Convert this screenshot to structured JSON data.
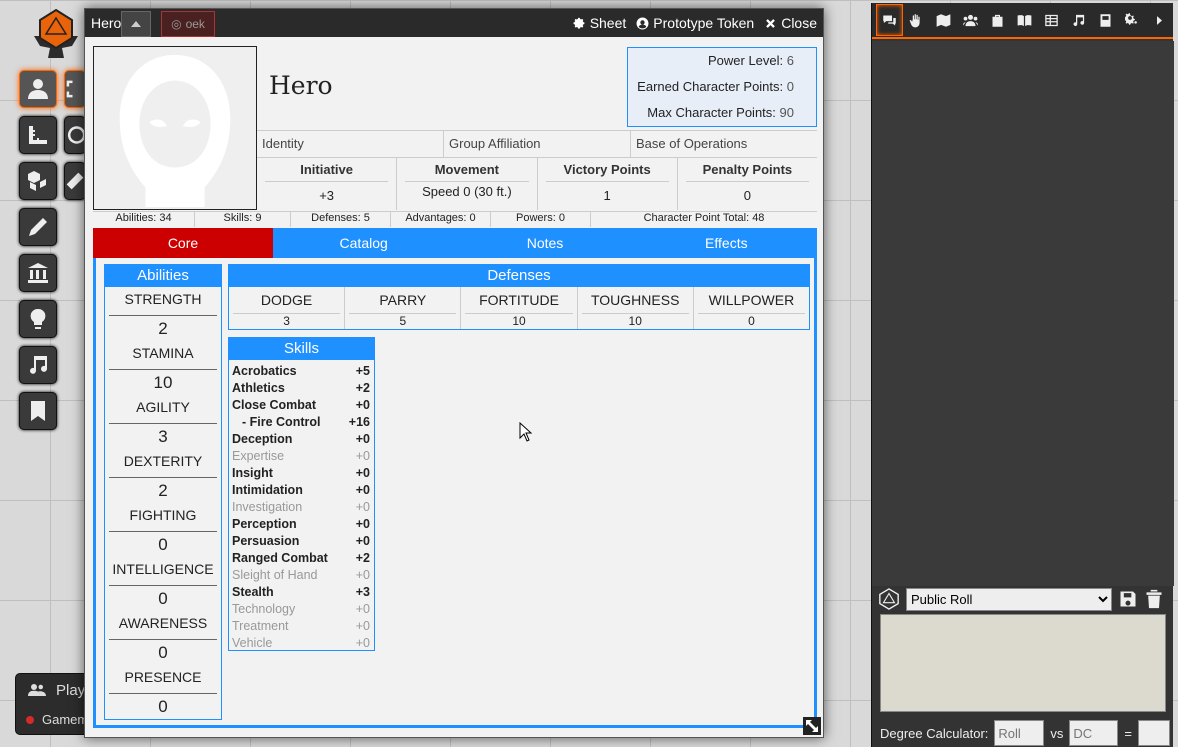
{
  "sheet": {
    "window_title": "Hero",
    "token_badge": "oek",
    "header_buttons": {
      "sheet": "Sheet",
      "prototype_token": "Prototype Token",
      "close": "Close"
    },
    "name": "Hero",
    "power_box": {
      "power_level_label": "Power Level:",
      "power_level": "6",
      "earned_label": "Earned Character Points:",
      "earned": "0",
      "max_label": "Max Character Points:",
      "max": "90"
    },
    "identity_row": [
      "Identity",
      "Group Affiliation",
      "Base of Operations"
    ],
    "stats": [
      {
        "label": "Initiative",
        "value": "+3"
      },
      {
        "label": "Movement",
        "value": "Speed 0 (30 ft.)"
      },
      {
        "label": "Victory Points",
        "value": "1"
      },
      {
        "label": "Penalty Points",
        "value": "0"
      }
    ],
    "totals": [
      "Abilities: 34",
      "Skills: 9",
      "Defenses: 5",
      "Advantages: 0",
      "Powers: 0",
      "Character Point Total: 48"
    ],
    "tabs": [
      "Core",
      "Catalog",
      "Notes",
      "Effects"
    ],
    "abilities_title": "Abilities",
    "abilities": [
      {
        "name": "STRENGTH",
        "value": "2"
      },
      {
        "name": "STAMINA",
        "value": "10"
      },
      {
        "name": "AGILITY",
        "value": "3"
      },
      {
        "name": "DEXTERITY",
        "value": "2"
      },
      {
        "name": "FIGHTING",
        "value": "0"
      },
      {
        "name": "INTELLIGENCE",
        "value": "0"
      },
      {
        "name": "AWARENESS",
        "value": "0"
      },
      {
        "name": "PRESENCE",
        "value": "0"
      }
    ],
    "defenses_title": "Defenses",
    "defenses": [
      {
        "name": "DODGE",
        "value": "3"
      },
      {
        "name": "PARRY",
        "value": "5"
      },
      {
        "name": "FORTITUDE",
        "value": "10"
      },
      {
        "name": "TOUGHNESS",
        "value": "10"
      },
      {
        "name": "WILLPOWER",
        "value": "0"
      }
    ],
    "skills_title": "Skills",
    "skills": [
      {
        "name": "Acrobatics",
        "value": "+5",
        "dim": false,
        "sub": false
      },
      {
        "name": "Athletics",
        "value": "+2",
        "dim": false,
        "sub": false
      },
      {
        "name": "Close Combat",
        "value": "+0",
        "dim": false,
        "sub": false
      },
      {
        "name": "- Fire Control",
        "value": "+16",
        "dim": false,
        "sub": true
      },
      {
        "name": "Deception",
        "value": "+0",
        "dim": false,
        "sub": false
      },
      {
        "name": "Expertise",
        "value": "+0",
        "dim": true,
        "sub": false
      },
      {
        "name": "Insight",
        "value": "+0",
        "dim": false,
        "sub": false
      },
      {
        "name": "Intimidation",
        "value": "+0",
        "dim": false,
        "sub": false
      },
      {
        "name": "Investigation",
        "value": "+0",
        "dim": true,
        "sub": false
      },
      {
        "name": "Perception",
        "value": "+0",
        "dim": false,
        "sub": false
      },
      {
        "name": "Persuasion",
        "value": "+0",
        "dim": false,
        "sub": false
      },
      {
        "name": "Ranged Combat",
        "value": "+2",
        "dim": false,
        "sub": false
      },
      {
        "name": "Sleight of Hand",
        "value": "+0",
        "dim": true,
        "sub": false
      },
      {
        "name": "Stealth",
        "value": "+3",
        "dim": false,
        "sub": false
      },
      {
        "name": "Technology",
        "value": "+0",
        "dim": true,
        "sub": false
      },
      {
        "name": "Treatment",
        "value": "+0",
        "dim": true,
        "sub": false
      },
      {
        "name": "Vehicle",
        "value": "+0",
        "dim": true,
        "sub": false
      }
    ]
  },
  "players": {
    "title": "Play",
    "gm": "Gamem"
  },
  "sidebar": {
    "tab_icons": [
      "chat-icon",
      "combat-icon",
      "scenes-icon",
      "actors-icon",
      "items-icon",
      "journal-icon",
      "tables-icon",
      "playlists-icon",
      "compendium-icon",
      "settings-icon",
      "collapse-icon"
    ],
    "roll_mode": "Public Roll",
    "roll_mode_options": [
      "Public Roll"
    ],
    "degree_label": "Degree Calculator:",
    "roll_placeholder": "Roll",
    "vs_label": "vs",
    "dc_placeholder": "DC",
    "equals": "="
  },
  "colors": {
    "accent": "#ff6400",
    "tab_blue": "#1e90ff",
    "tab_active": "#cc0000"
  }
}
